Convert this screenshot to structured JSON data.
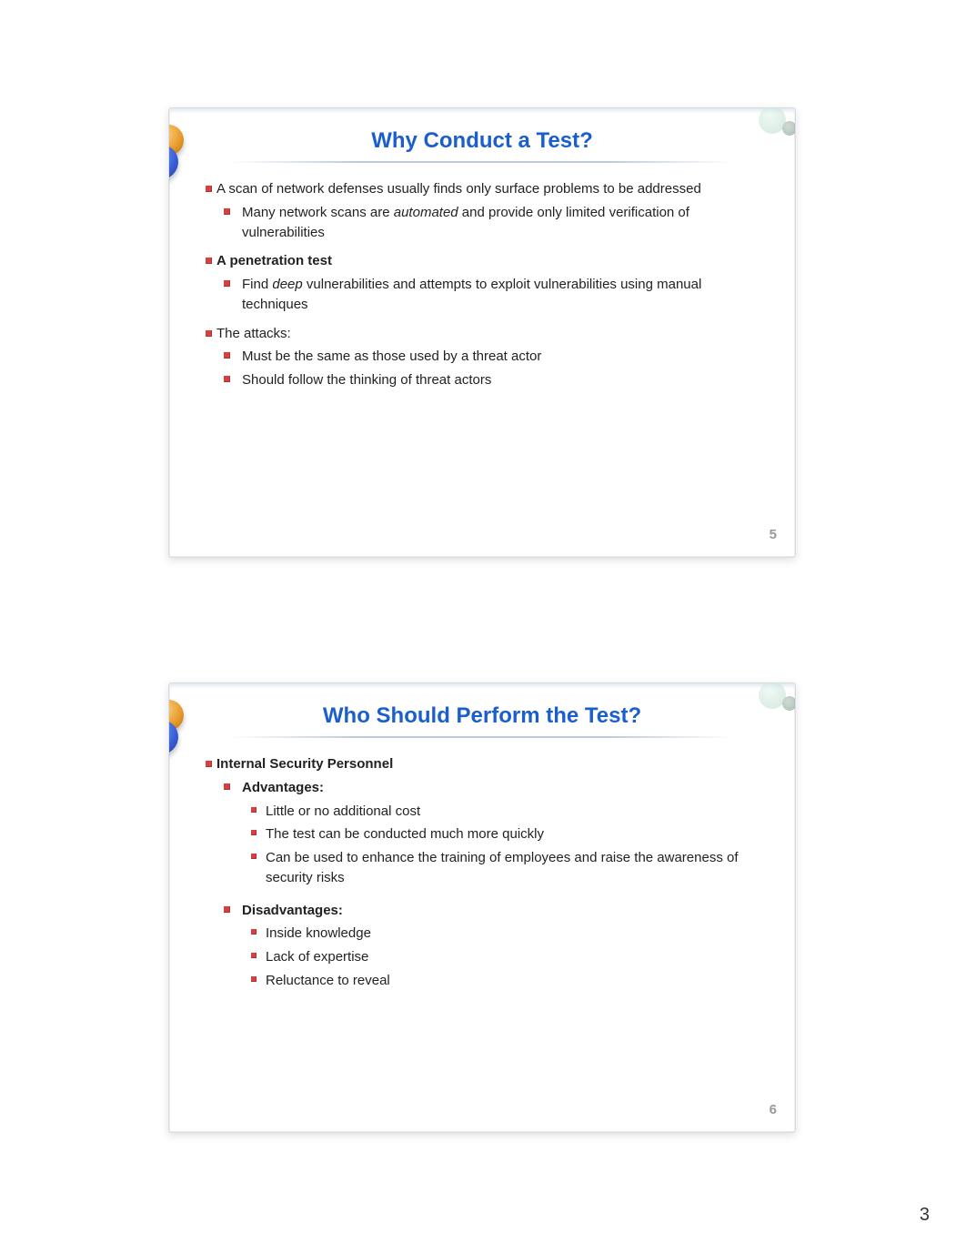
{
  "slide1": {
    "number": "5",
    "title": "Why Conduct a Test?",
    "b1": "A scan of network defenses usually finds only surface problems to be addressed",
    "b1_1a": "Many network scans are ",
    "b1_1_em": "automated",
    "b1_1b": " and provide only limited verification of vulnerabilities",
    "b2": "A penetration test",
    "b2_1a": "Find ",
    "b2_1_em": "deep",
    "b2_1b": " vulnerabilities and attempts to exploit vulnerabilities using manual techniques",
    "b3": "The attacks:",
    "b3_1": "Must be the same as those used by a threat actor",
    "b3_2": "Should follow the thinking of threat actors"
  },
  "slide2": {
    "number": "6",
    "title": "Who Should Perform the Test?",
    "b1": "Internal Security Personnel",
    "b1_1": "Advantages:",
    "b1_1_1": "Little or no additional cost",
    "b1_1_2": "The test can be conducted much more quickly",
    "b1_1_3": "Can be used to enhance the training of employees and raise the awareness of security risks",
    "b1_2": "Disadvantages:",
    "b1_2_1": "Inside knowledge",
    "b1_2_2": "Lack of expertise",
    "b1_2_3": "Reluctance to reveal"
  },
  "page_number": "3"
}
